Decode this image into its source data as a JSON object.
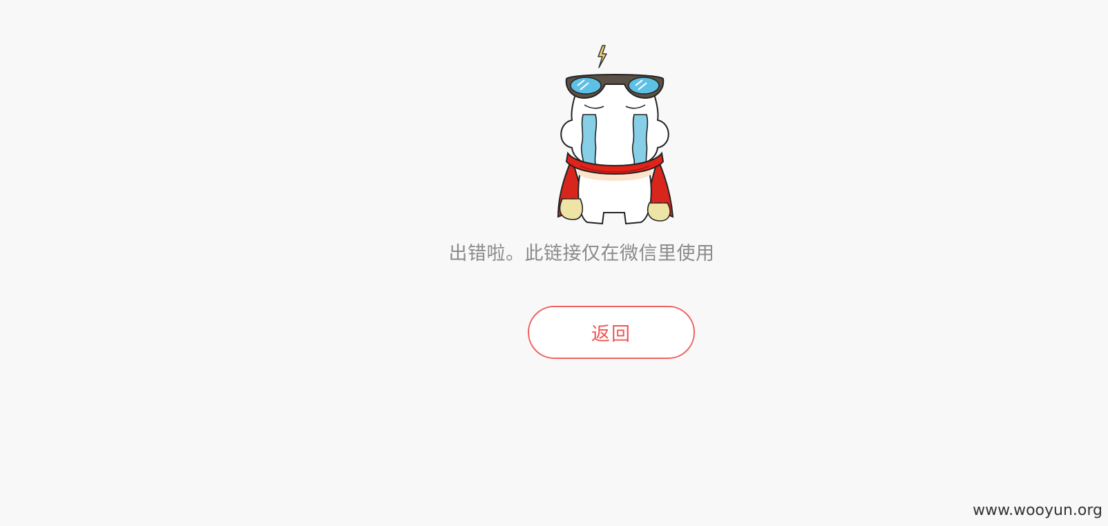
{
  "message": "出错啦。此链接仅在微信里使用",
  "back_button": {
    "label": "返回"
  },
  "watermark": "www.wooyun.org",
  "colors": {
    "background": "#f8f8f8",
    "accent": "#f06060",
    "message_text": "#8a8a8a"
  },
  "mascot": {
    "icon": "crying-mascot-icon"
  }
}
